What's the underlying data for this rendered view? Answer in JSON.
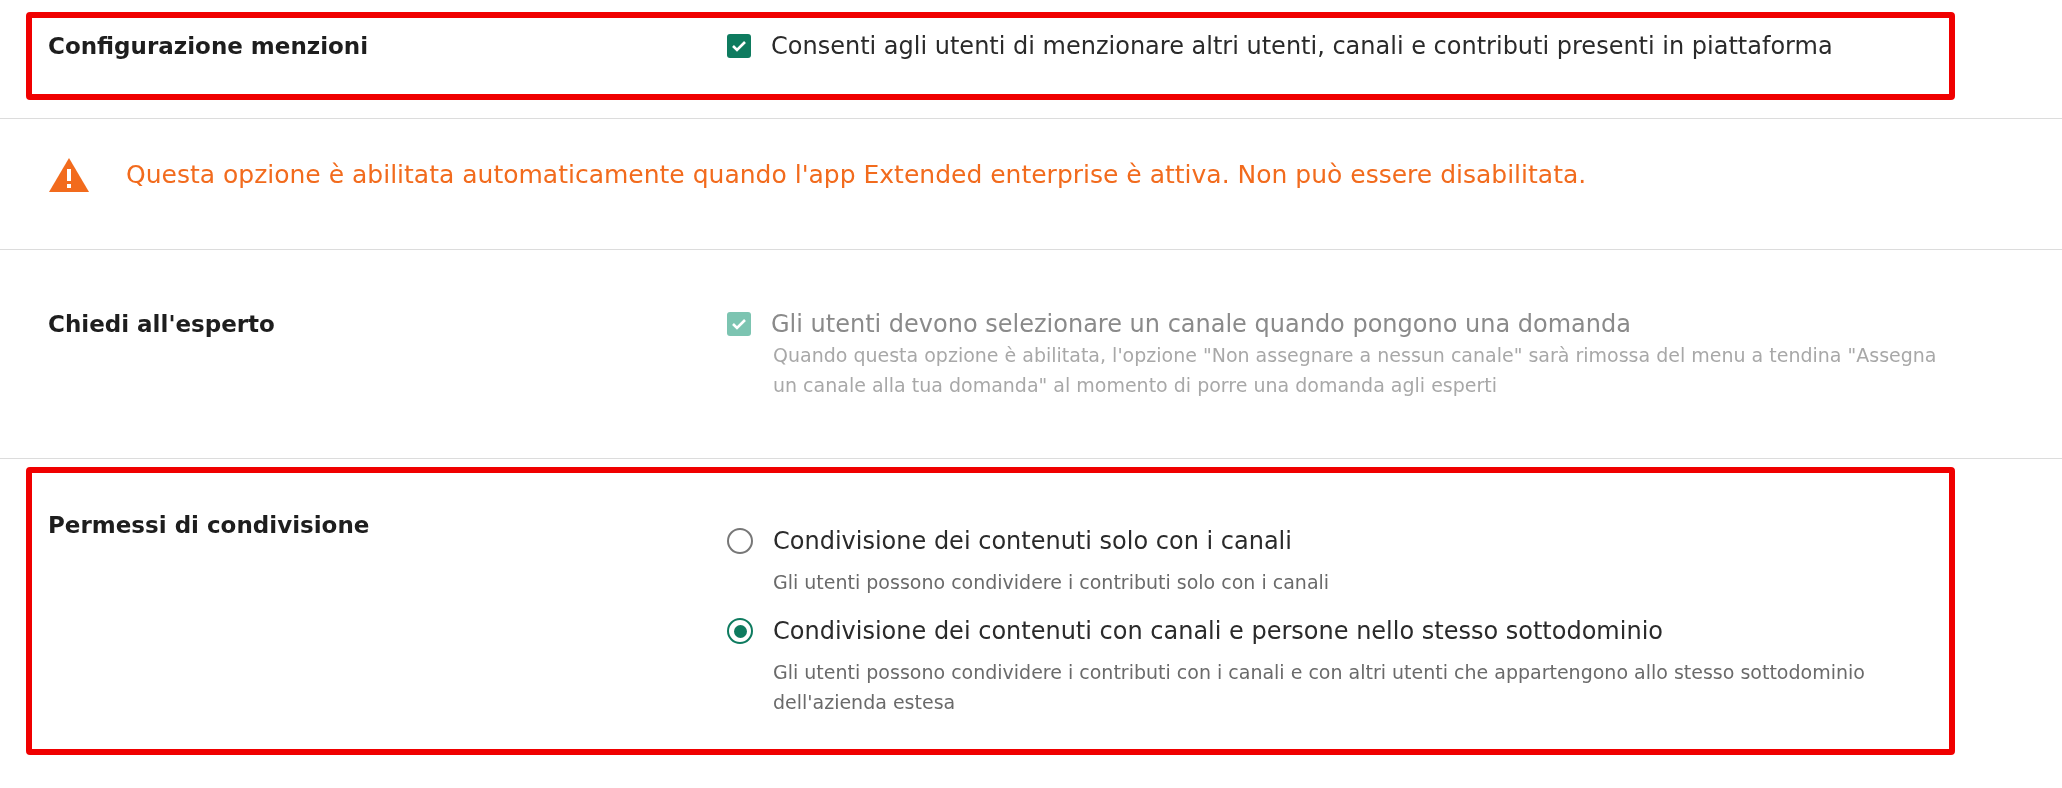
{
  "sections": [
    {
      "kind": "checkbox",
      "label": "Configurazione menzioni",
      "highlighted": true,
      "option": {
        "label": "Consenti agli utenti di menzionare altri utenti, canali e contributi presenti in piattaforma",
        "checked": true,
        "disabled": false
      }
    },
    {
      "kind": "warning",
      "text": "Questa opzione è abilitata automaticamente quando l'app Extended enterprise è attiva. Non può essere disabilitata."
    },
    {
      "kind": "checkbox",
      "label": "Chiedi all'esperto",
      "highlighted": false,
      "option": {
        "label": "Gli utenti devono selezionare un canale quando pongono una domanda",
        "checked": true,
        "disabled": true,
        "description": "Quando questa opzione è abilitata, l'opzione \"Non assegnare a nessun canale\" sarà rimossa del menu a tendina \"Assegna un canale alla tua domanda\" al momento di porre una domanda agli esperti"
      }
    },
    {
      "kind": "radio",
      "label": "Permessi di condivisione",
      "highlighted": true,
      "options": [
        {
          "label": "Condivisione dei contenuti solo con i canali",
          "description": "Gli utenti possono condividere i contributi solo con i canali",
          "selected": false
        },
        {
          "label": "Condivisione dei contenuti con canali e persone nello stesso sottodominio",
          "description": "Gli utenti possono condividere i contributi con i canali e con altri utenti che appartengono allo stesso sottodominio dell'azienda estesa",
          "selected": true
        }
      ]
    }
  ]
}
